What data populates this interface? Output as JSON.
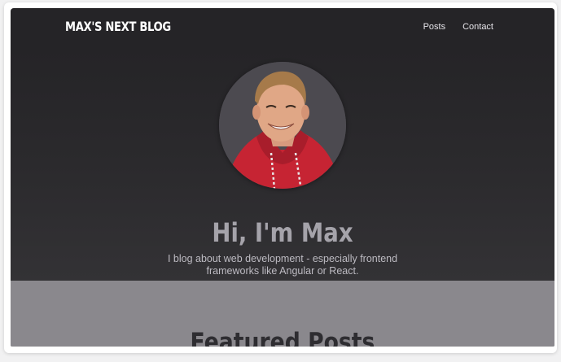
{
  "header": {
    "logo_text": "MAX'S NEXT BLOG",
    "nav": [
      {
        "label": "Posts"
      },
      {
        "label": "Contact"
      }
    ]
  },
  "hero": {
    "avatar_icon": "profile-photo",
    "title": "Hi, I'm Max",
    "subtitle": "I blog about web development - especially frontend frameworks like Angular or React."
  },
  "featured": {
    "title": "Featured Posts"
  },
  "colors": {
    "header_bg": "#252427",
    "hero_title": "#a5a3aa",
    "featured_bg": "#8a888d",
    "featured_title": "#2e2d31",
    "hoodie_red": "#c62433"
  }
}
